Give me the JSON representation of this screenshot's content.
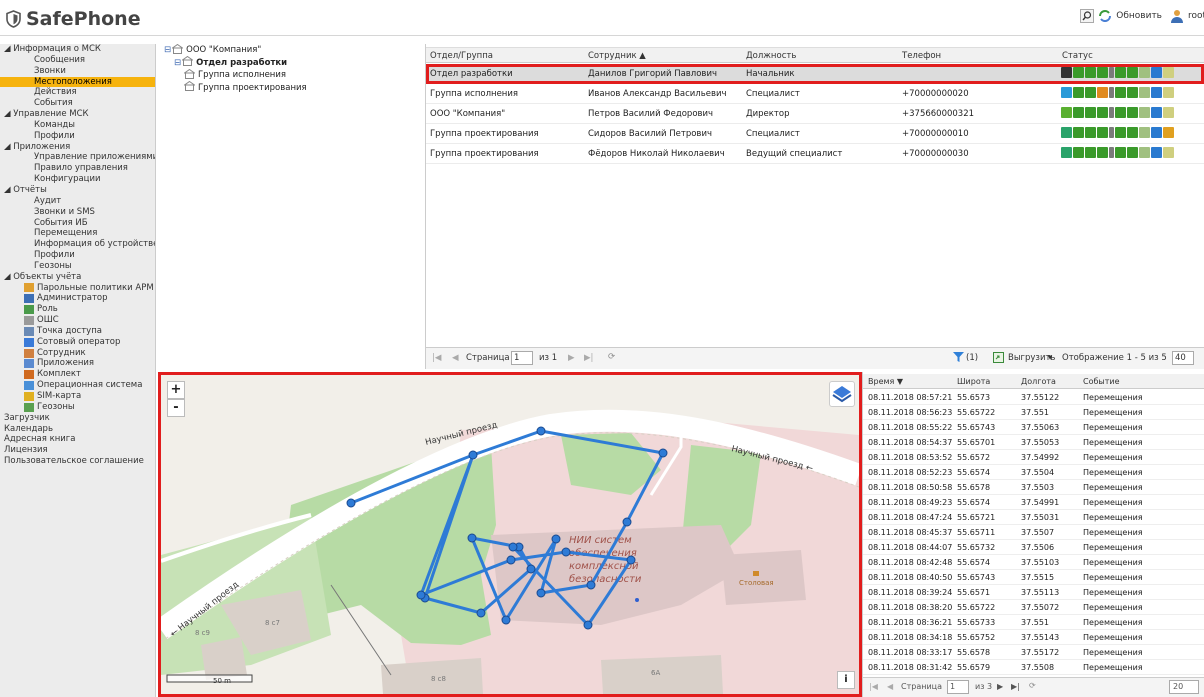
{
  "app": {
    "title": "SafePhone",
    "refresh_label": "Обновить",
    "user": "root"
  },
  "sidebar": {
    "items": [
      {
        "label": "◢ Информация о МСК",
        "indent": 0,
        "icon": "",
        "selected": false
      },
      {
        "label": "Сообщения",
        "indent": 2,
        "icon": "",
        "selected": false
      },
      {
        "label": "Звонки",
        "indent": 2,
        "icon": "",
        "selected": false
      },
      {
        "label": "Местоположения",
        "indent": 2,
        "icon": "",
        "selected": true
      },
      {
        "label": "Действия",
        "indent": 2,
        "icon": "",
        "selected": false
      },
      {
        "label": "События",
        "indent": 2,
        "icon": "",
        "selected": false
      },
      {
        "label": "◢ Управление МСК",
        "indent": 0,
        "icon": "",
        "selected": false
      },
      {
        "label": "Команды",
        "indent": 2,
        "icon": "",
        "selected": false
      },
      {
        "label": "Профили",
        "indent": 2,
        "icon": "",
        "selected": false
      },
      {
        "label": "◢ Приложения",
        "indent": 0,
        "icon": "",
        "selected": false
      },
      {
        "label": "Управление приложениями",
        "indent": 2,
        "icon": "",
        "selected": false
      },
      {
        "label": "Правило управления",
        "indent": 2,
        "icon": "",
        "selected": false
      },
      {
        "label": "Конфигурации",
        "indent": 2,
        "icon": "",
        "selected": false
      },
      {
        "label": "◢ Отчёты",
        "indent": 0,
        "icon": "",
        "selected": false
      },
      {
        "label": "Аудит",
        "indent": 2,
        "icon": "",
        "selected": false
      },
      {
        "label": "Звонки и SMS",
        "indent": 2,
        "icon": "",
        "selected": false
      },
      {
        "label": "События ИБ",
        "indent": 2,
        "icon": "",
        "selected": false
      },
      {
        "label": "Перемещения",
        "indent": 2,
        "icon": "",
        "selected": false
      },
      {
        "label": "Информация об устройстве",
        "indent": 2,
        "icon": "",
        "selected": false
      },
      {
        "label": "Профили",
        "indent": 2,
        "icon": "",
        "selected": false
      },
      {
        "label": "Геозоны",
        "indent": 2,
        "icon": "",
        "selected": false
      },
      {
        "label": "◢ Объекты учёта",
        "indent": 0,
        "icon": "",
        "selected": false
      },
      {
        "label": "Парольные политики АРМ",
        "indent": 2,
        "icon": "policy-icon",
        "selected": false
      },
      {
        "label": "Администратор",
        "indent": 2,
        "icon": "admin-icon",
        "selected": false
      },
      {
        "label": "Роль",
        "indent": 2,
        "icon": "role-icon",
        "selected": false
      },
      {
        "label": "ОШС",
        "indent": 2,
        "icon": "org-icon",
        "selected": false
      },
      {
        "label": "Точка доступа",
        "indent": 2,
        "icon": "access-point-icon",
        "selected": false
      },
      {
        "label": "Сотовый оператор",
        "indent": 2,
        "icon": "operator-icon",
        "selected": false
      },
      {
        "label": "Сотрудник",
        "indent": 2,
        "icon": "employee-icon",
        "selected": false
      },
      {
        "label": "Приложения",
        "indent": 2,
        "icon": "app-icon",
        "selected": false
      },
      {
        "label": "Комплект",
        "indent": 2,
        "icon": "kit-icon",
        "selected": false
      },
      {
        "label": "Операционная система",
        "indent": 2,
        "icon": "os-icon",
        "selected": false
      },
      {
        "label": "SIM-карта",
        "indent": 2,
        "icon": "sim-icon",
        "selected": false
      },
      {
        "label": "Геозоны",
        "indent": 2,
        "icon": "geozone-icon",
        "selected": false
      },
      {
        "label": "Загрузчик",
        "indent": 0,
        "icon": "",
        "selected": false
      },
      {
        "label": "Календарь",
        "indent": 0,
        "icon": "",
        "selected": false
      },
      {
        "label": "Адресная книга",
        "indent": 0,
        "icon": "",
        "selected": false
      },
      {
        "label": "Лицензия",
        "indent": 0,
        "icon": "",
        "selected": false
      },
      {
        "label": "Пользовательское соглашение",
        "indent": 0,
        "icon": "",
        "selected": false
      }
    ]
  },
  "tree": {
    "items": [
      {
        "label": "ООО \"Компания\"",
        "level": 0,
        "bold": false
      },
      {
        "label": "Отдел разработки",
        "level": 1,
        "bold": true
      },
      {
        "label": "Группа исполнения",
        "level": 2,
        "bold": false
      },
      {
        "label": "Группа проектирования",
        "level": 2,
        "bold": false
      }
    ]
  },
  "grid": {
    "columns": [
      "Отдел/Группа",
      "Сотрудник ▲",
      "Должность",
      "Телефон",
      "Статус"
    ],
    "rows": [
      {
        "group": "Отдел разработки",
        "employee": "Данилов Григорий Павлович",
        "position": "Начальник",
        "phone": "",
        "os": "ios",
        "selected": true
      },
      {
        "group": "Группа исполнения",
        "employee": "Иванов Александр Васильевич",
        "position": "Специалист",
        "phone": "+70000000020",
        "os": "windows",
        "selected": false
      },
      {
        "group": "ООО \"Компания\"",
        "employee": "Петров Василий Федорович",
        "position": "Директор",
        "phone": "+375660000321",
        "os": "android",
        "selected": false
      },
      {
        "group": "Группа проектирования",
        "employee": "Сидоров Василий Петрович",
        "position": "Специалист",
        "phone": "+70000000010",
        "os": "huawei",
        "selected": false
      },
      {
        "group": "Группа проектирования",
        "employee": "Фёдоров Николай Николаевич",
        "position": "Ведущий специалист",
        "phone": "+70000000030",
        "os": "huawei",
        "selected": false
      }
    ],
    "pager": {
      "page_label": "Страница",
      "page": "1",
      "of": "из 1",
      "filter": "(1)",
      "export": "Выгрузить",
      "display": "Отображение 1 - 5 из 5",
      "per_page": "40"
    }
  },
  "map": {
    "streets": [
      "Научный проезд",
      "Научный проезд",
      "Научный проезд"
    ],
    "building_label": "НИИ систем обеспечения комплексной безопасности",
    "canteen": "Столовая",
    "houses": [
      "8 с7",
      "8 с8",
      "8 с9",
      "6А"
    ],
    "scale": "50 m",
    "zoom_in": "+",
    "zoom_out": "-",
    "info": "i",
    "track_color": "#2e7bd6"
  },
  "log": {
    "columns": [
      "Время ▼",
      "Широта",
      "Долгота",
      "Событие"
    ],
    "rows": [
      [
        "08.11.2018 08:57:21",
        "55.6573",
        "37.55122",
        "Перемещения"
      ],
      [
        "08.11.2018 08:56:23",
        "55.65722",
        "37.551",
        "Перемещения"
      ],
      [
        "08.11.2018 08:55:22",
        "55.65743",
        "37.55063",
        "Перемещения"
      ],
      [
        "08.11.2018 08:54:37",
        "55.65701",
        "37.55053",
        "Перемещения"
      ],
      [
        "08.11.2018 08:53:52",
        "55.6572",
        "37.54992",
        "Перемещения"
      ],
      [
        "08.11.2018 08:52:23",
        "55.6574",
        "37.5504",
        "Перемещения"
      ],
      [
        "08.11.2018 08:50:58",
        "55.6578",
        "37.5503",
        "Перемещения"
      ],
      [
        "08.11.2018 08:49:23",
        "55.6574",
        "37.54991",
        "Перемещения"
      ],
      [
        "08.11.2018 08:47:24",
        "55.65721",
        "37.55031",
        "Перемещения"
      ],
      [
        "08.11.2018 08:45:37",
        "55.65711",
        "37.5507",
        "Перемещения"
      ],
      [
        "08.11.2018 08:44:07",
        "55.65732",
        "37.5506",
        "Перемещения"
      ],
      [
        "08.11.2018 08:42:48",
        "55.6574",
        "37.55103",
        "Перемещения"
      ],
      [
        "08.11.2018 08:40:50",
        "55.65743",
        "37.5515",
        "Перемещения"
      ],
      [
        "08.11.2018 08:39:24",
        "55.6571",
        "37.55113",
        "Перемещения"
      ],
      [
        "08.11.2018 08:38:20",
        "55.65722",
        "37.55072",
        "Перемещения"
      ],
      [
        "08.11.2018 08:36:21",
        "55.65733",
        "37.551",
        "Перемещения"
      ],
      [
        "08.11.2018 08:34:18",
        "55.65752",
        "37.55143",
        "Перемещения"
      ],
      [
        "08.11.2018 08:33:17",
        "55.6578",
        "37.55172",
        "Перемещения"
      ],
      [
        "08.11.2018 08:31:42",
        "55.6579",
        "37.5508",
        "Перемещения"
      ]
    ],
    "pager": {
      "page_label": "Страница",
      "page": "1",
      "of": "из 3",
      "per_page": "20"
    }
  }
}
